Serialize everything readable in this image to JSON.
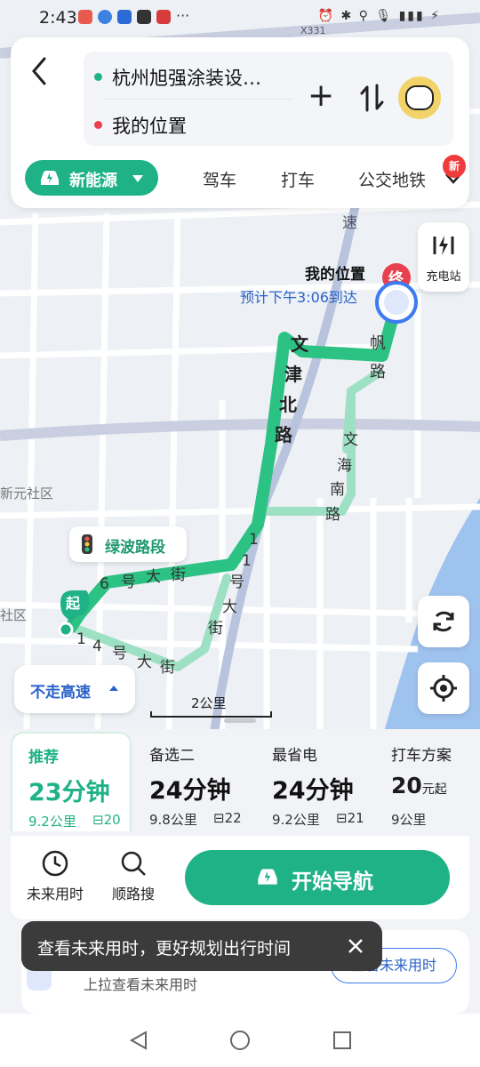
{
  "status": {
    "time": "2:43",
    "right_icons": "⏰ ✱ ⚲ 🎙 ▮▮▮ ⚡"
  },
  "search": {
    "from": "杭州旭强涂装设…",
    "to": "我的位置",
    "add_icon": "plus-icon",
    "swap_icon": "swap-icon"
  },
  "tabs": {
    "active": "新能源",
    "items": [
      "驾车",
      "打车",
      "公交地铁"
    ],
    "new_badge": "新"
  },
  "map": {
    "road_label_x331": "X331",
    "destination_label": "我的位置",
    "destination_badge": "终",
    "eta": "预计下午3:06到达",
    "charging_station": "充电站",
    "green_wave": "绿波路段",
    "start_badge": "起",
    "scale": "2公里",
    "area_label_1": "新元社区",
    "area_label_2": "社区",
    "road_labels": {
      "wenjin": "文津北路",
      "fanlu": "帆路",
      "wenhai": "文海南路",
      "road_11": "11号大街",
      "road_6": "6号大街",
      "road_14": "14号大街",
      "su": "速"
    },
    "no_highway": "不走高速"
  },
  "colors": {
    "accent": "#1fb286",
    "route": "#2cc283",
    "route_light": "#9ee0c4",
    "destination": "#e8404e",
    "water": "#9fc3ef"
  },
  "routes": [
    {
      "name": "推荐",
      "duration": "23分钟",
      "distance": "9.2公里",
      "lights": "20",
      "selected": true
    },
    {
      "name": "备选二",
      "duration": "24分钟",
      "distance": "9.8公里",
      "lights": "22",
      "selected": false
    },
    {
      "name": "最省电",
      "duration": "24分钟",
      "distance": "9.2公里",
      "lights": "21",
      "selected": false
    },
    {
      "name": "打车方案",
      "duration": "20",
      "duration_suffix": "元起",
      "distance": "9公里",
      "selected": false
    }
  ],
  "actions": {
    "future_time": "未来用时",
    "along_search": "顺路搜",
    "start_nav": "开始导航"
  },
  "toast": {
    "text": "查看未来用时，更好规划出行时间"
  },
  "sub_panel": {
    "hint": "上拉查看未来用时",
    "button": "查看未来用时"
  }
}
